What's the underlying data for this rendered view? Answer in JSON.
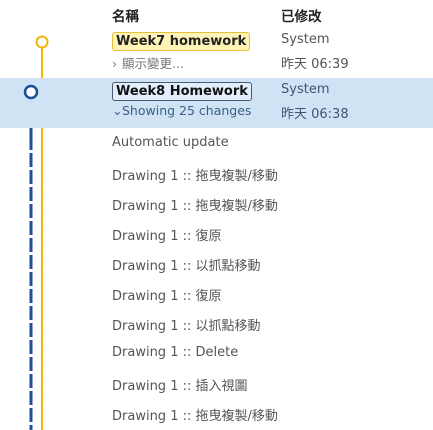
{
  "header": {
    "name_col": "名稱",
    "modified_col": "已修改"
  },
  "versions": [
    {
      "name": "Week7 homework",
      "sub": "顯示變更...",
      "by": "System",
      "time": "昨天 06:39",
      "color": "#f2b705",
      "selected": false
    },
    {
      "name": "Week8 Homework",
      "sub": "Showing 25 changes",
      "by": "System",
      "time": "昨天 06:38",
      "color": "#1f4e96",
      "selected": true
    }
  ],
  "changes": [
    "Automatic update",
    "Drawing 1 :: 拖曳複製/移動",
    "Drawing 1 :: 拖曳複製/移動",
    "Drawing 1 :: 復原",
    "Drawing 1 :: 以抓點移動",
    "Drawing 1 :: 復原",
    "Drawing 1 :: 以抓點移動",
    "Drawing 1 :: Delete",
    "Drawing 1 :: 插入視圖",
    "Drawing 1 :: 拖曳複製/移動"
  ],
  "icons": {
    "collapsed": "chevron-right-icon",
    "expanded": "chevron-down-icon"
  }
}
